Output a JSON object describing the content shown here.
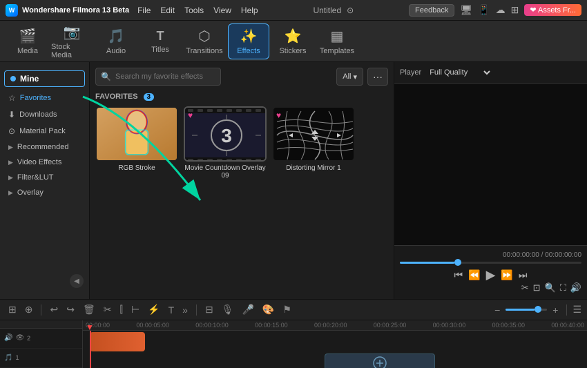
{
  "app": {
    "name": "Wondershare Filmora 13 Beta",
    "title": "Untitled"
  },
  "top_menu": {
    "items": [
      "File",
      "Edit",
      "Tools",
      "View",
      "Help"
    ]
  },
  "toolbar": {
    "items": [
      {
        "label": "Media",
        "icon": "🎬"
      },
      {
        "label": "Stock Media",
        "icon": "📷"
      },
      {
        "label": "Audio",
        "icon": "🎵"
      },
      {
        "label": "Titles",
        "icon": "T"
      },
      {
        "label": "Transitions",
        "icon": "⬡"
      },
      {
        "label": "Effects",
        "icon": "✨"
      },
      {
        "label": "Stickers",
        "icon": "⭐"
      },
      {
        "label": "Templates",
        "icon": "▦"
      }
    ],
    "active": "Effects"
  },
  "sidebar": {
    "mine_label": "Mine",
    "items": [
      {
        "label": "Favorites",
        "icon": "☆",
        "active": true
      },
      {
        "label": "Downloads",
        "icon": "⬇"
      },
      {
        "label": "Material Pack",
        "icon": "⊙"
      },
      {
        "label": "Recommended",
        "icon": "▸"
      },
      {
        "label": "Video Effects",
        "icon": "▸"
      },
      {
        "label": "Filter&LUT",
        "icon": "▸"
      },
      {
        "label": "Overlay",
        "icon": "▸"
      }
    ]
  },
  "search": {
    "placeholder": "Search my favorite effects",
    "filter_label": "All",
    "filter_icon": "▾"
  },
  "favorites": {
    "title": "FAVORITES",
    "count": "3",
    "effects": [
      {
        "name": "RGB Stroke",
        "id": "rgb-stroke"
      },
      {
        "name": "Movie Countdown Overlay 09",
        "id": "movie-countdown"
      },
      {
        "name": "Distorting Mirror 1",
        "id": "distorting-mirror"
      }
    ]
  },
  "player": {
    "label": "Player",
    "quality": "Full Quality",
    "time_current": "00:00:00:00",
    "time_total": "00:00:00:00",
    "progress": 30
  },
  "timeline": {
    "marks": [
      "00:00:00",
      "00:00:05:00",
      "00:00:10:00",
      "00:00:15:00",
      "00:00:20:00",
      "00:00:25:00",
      "00:00:30:00",
      "00:00:35:00",
      "00:00:40:00"
    ]
  }
}
